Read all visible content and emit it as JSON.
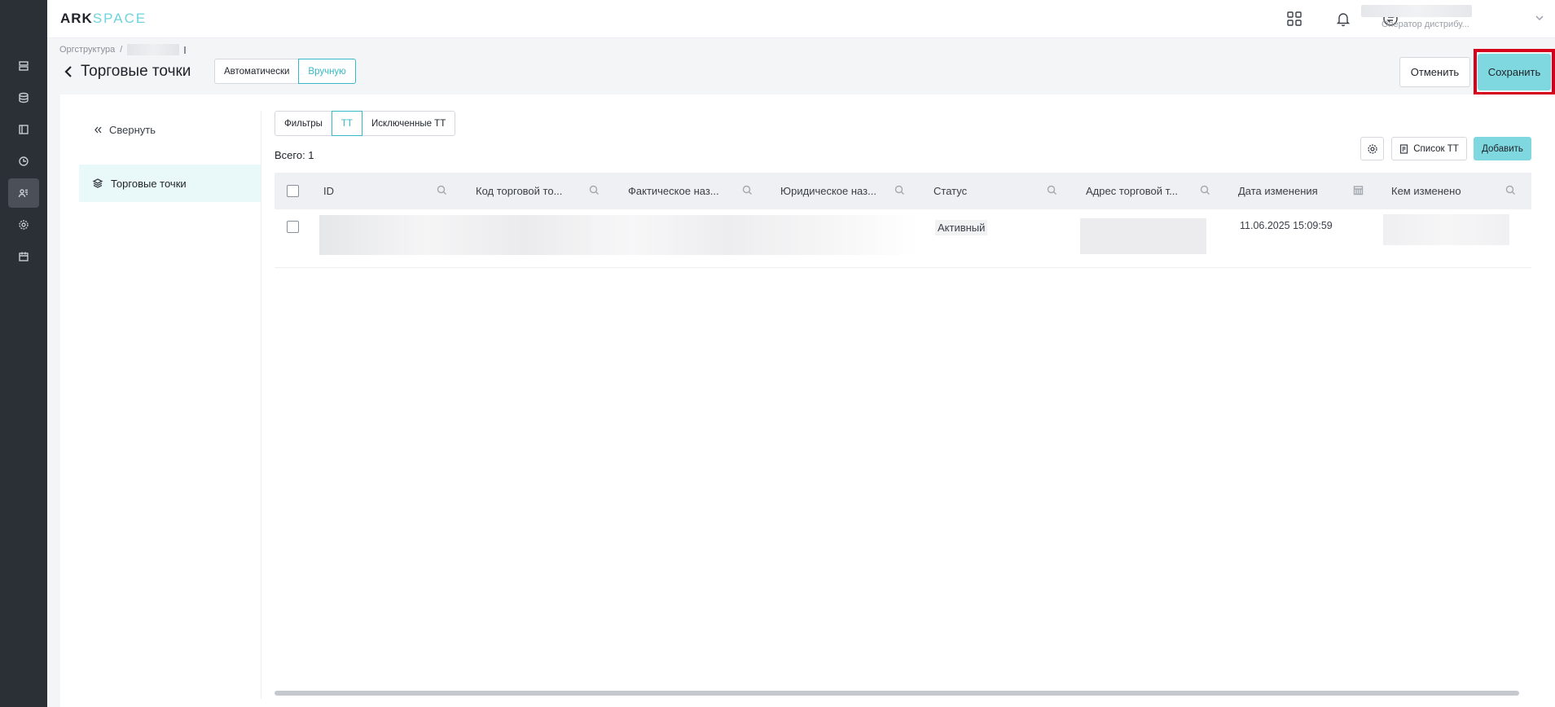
{
  "app": {
    "logo_part1": "ARK",
    "logo_part2": "SPACE",
    "accent_color": "#7fd8df",
    "highlight_color": "#d6001c"
  },
  "rail": {
    "icons": [
      "server-icon",
      "database-icon",
      "layout-icon",
      "clock-icon",
      "users-icon",
      "gear-icon",
      "calendar-icon"
    ],
    "active": "users-icon"
  },
  "topbar": {
    "icons": [
      "apps-grid-icon",
      "bell-icon",
      "sync-icon"
    ],
    "user_role": "Оператор дистрибу..."
  },
  "breadcrumb": {
    "root": "Оргструктура",
    "separator": "/"
  },
  "header": {
    "title": "Торговые точки",
    "mode_auto": "Автоматически",
    "mode_manual": "Вручную",
    "cancel_label": "Отменить",
    "save_label": "Сохранить"
  },
  "sidebar": {
    "collapse_label": "Свернуть",
    "item_label": "Торговые точки"
  },
  "segments": {
    "filters": "Фильтры",
    "tt": "ТТ",
    "excluded": "Исключенные ТТ"
  },
  "toolbar": {
    "total": "Всего: 1",
    "list_label": "Список ТТ",
    "add_label": "Добавить"
  },
  "table": {
    "columns": [
      "ID",
      "Код торговой то...",
      "Фактическое наз...",
      "Юридическое наз...",
      "Статус",
      "Адрес торговой т...",
      "Дата изменения",
      "Кем изменено"
    ],
    "rows": [
      {
        "status": "Активный",
        "date": "11.06.2025 15:09:59"
      }
    ]
  }
}
